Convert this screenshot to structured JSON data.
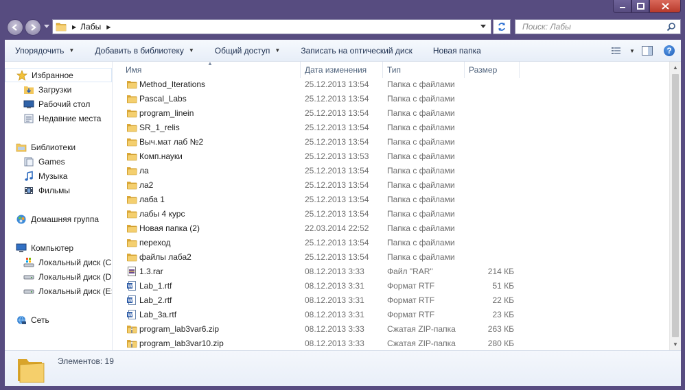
{
  "window": {
    "controls": {
      "minimize": "minimize-icon",
      "maximize": "maximize-icon",
      "close": "close-icon"
    }
  },
  "address": {
    "path": [
      "Лабы"
    ],
    "search_placeholder": "Поиск: Лабы"
  },
  "toolbar": {
    "organize": "Упорядочить",
    "add_to_library": "Добавить в библиотеку",
    "share": "Общий доступ",
    "burn": "Записать на оптический диск",
    "new_folder": "Новая папка"
  },
  "nav": {
    "favorites": "Избранное",
    "favorites_items": [
      "Загрузки",
      "Рабочий стол",
      "Недавние места"
    ],
    "libraries": "Библиотеки",
    "libraries_items": [
      "Games",
      "Музыка",
      "Фильмы"
    ],
    "homegroup": "Домашняя группа",
    "computer": "Компьютер",
    "computer_items": [
      "Локальный диск (C:)",
      "Локальный диск (D:)",
      "Локальный диск (E:)"
    ],
    "network": "Сеть"
  },
  "columns": {
    "name": "Имя",
    "date": "Дата изменения",
    "type": "Тип",
    "size": "Размер"
  },
  "files": [
    {
      "name": "Method_Iterations",
      "date": "25.12.2013 13:54",
      "type": "Папка с файлами",
      "size": "",
      "icon": "folder"
    },
    {
      "name": "Pascal_Labs",
      "date": "25.12.2013 13:54",
      "type": "Папка с файлами",
      "size": "",
      "icon": "folder"
    },
    {
      "name": "program_linein",
      "date": "25.12.2013 13:54",
      "type": "Папка с файлами",
      "size": "",
      "icon": "folder"
    },
    {
      "name": "SR_1_relis",
      "date": "25.12.2013 13:54",
      "type": "Папка с файлами",
      "size": "",
      "icon": "folder"
    },
    {
      "name": "Выч.мат лаб №2",
      "date": "25.12.2013 13:54",
      "type": "Папка с файлами",
      "size": "",
      "icon": "folder"
    },
    {
      "name": "Комп.науки",
      "date": "25.12.2013 13:53",
      "type": "Папка с файлами",
      "size": "",
      "icon": "folder"
    },
    {
      "name": "ла",
      "date": "25.12.2013 13:54",
      "type": "Папка с файлами",
      "size": "",
      "icon": "folder"
    },
    {
      "name": "ла2",
      "date": "25.12.2013 13:54",
      "type": "Папка с файлами",
      "size": "",
      "icon": "folder"
    },
    {
      "name": "лаба 1",
      "date": "25.12.2013 13:54",
      "type": "Папка с файлами",
      "size": "",
      "icon": "folder"
    },
    {
      "name": "лабы 4 курс",
      "date": "25.12.2013 13:54",
      "type": "Папка с файлами",
      "size": "",
      "icon": "folder"
    },
    {
      "name": "Новая папка (2)",
      "date": "22.03.2014 22:52",
      "type": "Папка с файлами",
      "size": "",
      "icon": "folder"
    },
    {
      "name": "переход",
      "date": "25.12.2013 13:54",
      "type": "Папка с файлами",
      "size": "",
      "icon": "folder"
    },
    {
      "name": "файлы лаба2",
      "date": "25.12.2013 13:54",
      "type": "Папка с файлами",
      "size": "",
      "icon": "folder"
    },
    {
      "name": "1.3.rar",
      "date": "08.12.2013 3:33",
      "type": "Файл \"RAR\"",
      "size": "214 КБ",
      "icon": "rar"
    },
    {
      "name": "Lab_1.rtf",
      "date": "08.12.2013 3:31",
      "type": "Формат RTF",
      "size": "51 КБ",
      "icon": "rtf"
    },
    {
      "name": "Lab_2.rtf",
      "date": "08.12.2013 3:31",
      "type": "Формат RTF",
      "size": "22 КБ",
      "icon": "rtf"
    },
    {
      "name": "Lab_3a.rtf",
      "date": "08.12.2013 3:31",
      "type": "Формат RTF",
      "size": "23 КБ",
      "icon": "rtf"
    },
    {
      "name": "program_lab3var6.zip",
      "date": "08.12.2013 3:33",
      "type": "Сжатая ZIP-папка",
      "size": "263 КБ",
      "icon": "zip"
    },
    {
      "name": "program_lab3var10.zip",
      "date": "08.12.2013 3:33",
      "type": "Сжатая ZIP-папка",
      "size": "280 КБ",
      "icon": "zip"
    }
  ],
  "status": {
    "count_text": "Элементов: 19"
  }
}
